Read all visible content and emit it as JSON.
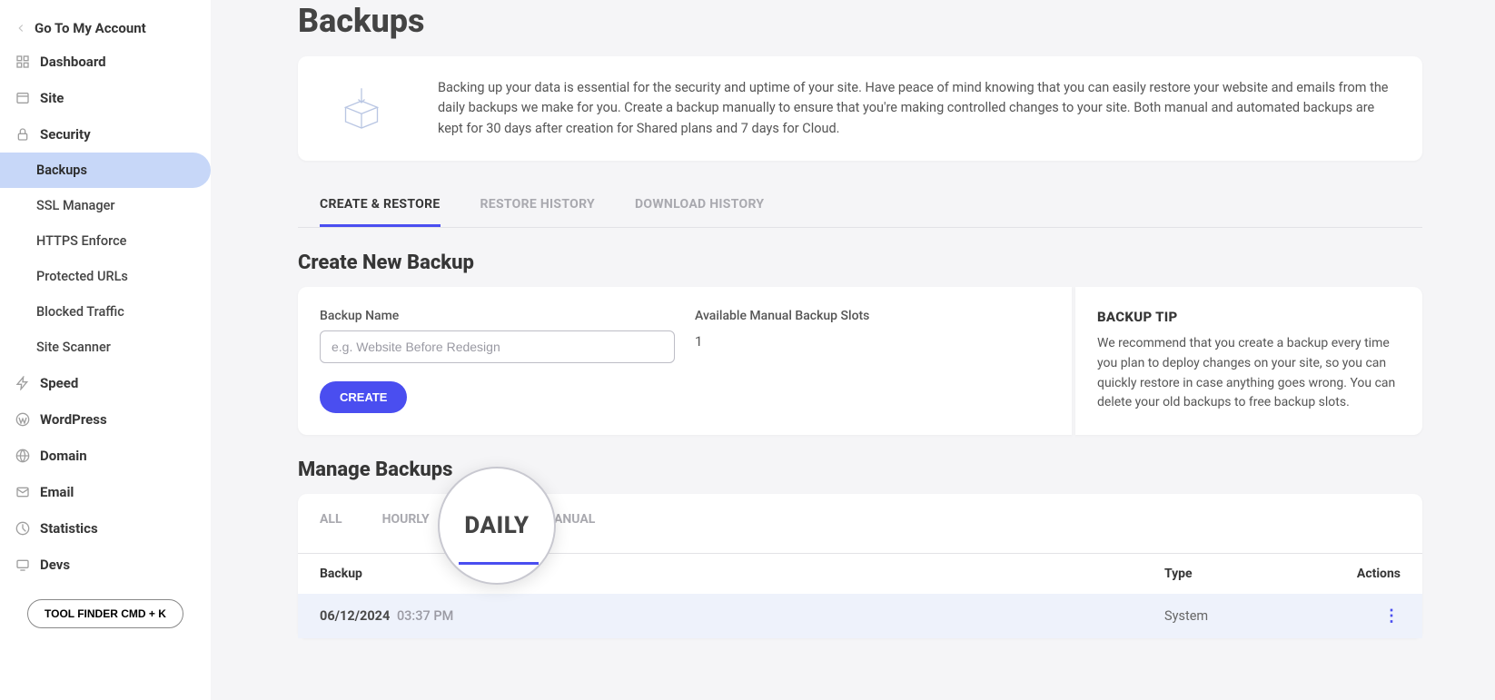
{
  "sidebar": {
    "go_account": "Go To My Account",
    "items": [
      {
        "label": "Dashboard",
        "icon": "dashboard-icon"
      },
      {
        "label": "Site",
        "icon": "site-icon"
      },
      {
        "label": "Security",
        "icon": "lock-icon",
        "children": [
          {
            "label": "Backups",
            "active": true
          },
          {
            "label": "SSL Manager"
          },
          {
            "label": "HTTPS Enforce"
          },
          {
            "label": "Protected URLs"
          },
          {
            "label": "Blocked Traffic"
          },
          {
            "label": "Site Scanner"
          }
        ]
      },
      {
        "label": "Speed",
        "icon": "speed-icon"
      },
      {
        "label": "WordPress",
        "icon": "wordpress-icon"
      },
      {
        "label": "Domain",
        "icon": "globe-icon"
      },
      {
        "label": "Email",
        "icon": "mail-icon"
      },
      {
        "label": "Statistics",
        "icon": "stats-icon"
      },
      {
        "label": "Devs",
        "icon": "devs-icon"
      }
    ],
    "tool_finder": "TOOL FINDER CMD + K"
  },
  "page": {
    "title": "Backups",
    "intro": "Backing up your data is essential for the security and uptime of your site. Have peace of mind knowing that you can easily restore your website and emails from the daily backups we make for you. Create a backup manually to ensure that you're making controlled changes to your site. Both manual and automated backups are kept for 30 days after creation for Shared plans and 7 days for Cloud."
  },
  "tabs": [
    {
      "label": "CREATE & RESTORE",
      "active": true
    },
    {
      "label": "RESTORE HISTORY"
    },
    {
      "label": "DOWNLOAD HISTORY"
    }
  ],
  "create": {
    "heading": "Create New Backup",
    "name_label": "Backup Name",
    "name_placeholder": "e.g. Website Before Redesign",
    "slots_label": "Available Manual Backup Slots",
    "slots_value": "1",
    "button": "CREATE",
    "tip_title": "BACKUP TIP",
    "tip_text": "We recommend that you create a backup every time you plan to deploy changes on your site, so you can quickly restore in case anything goes wrong. You can delete your old backups to free backup slots."
  },
  "manage": {
    "heading": "Manage Backups",
    "tabs": [
      {
        "label": "ALL"
      },
      {
        "label": "HOURLY"
      },
      {
        "label": "DAILY",
        "active": true
      },
      {
        "label": "MANUAL"
      }
    ],
    "columns": {
      "c1": "Backup",
      "c2": "Type",
      "c3": "Actions"
    },
    "rows": [
      {
        "date": "06/12/2024",
        "time": "03:37 PM",
        "type": "System"
      }
    ],
    "magnifier": "DAILY"
  }
}
